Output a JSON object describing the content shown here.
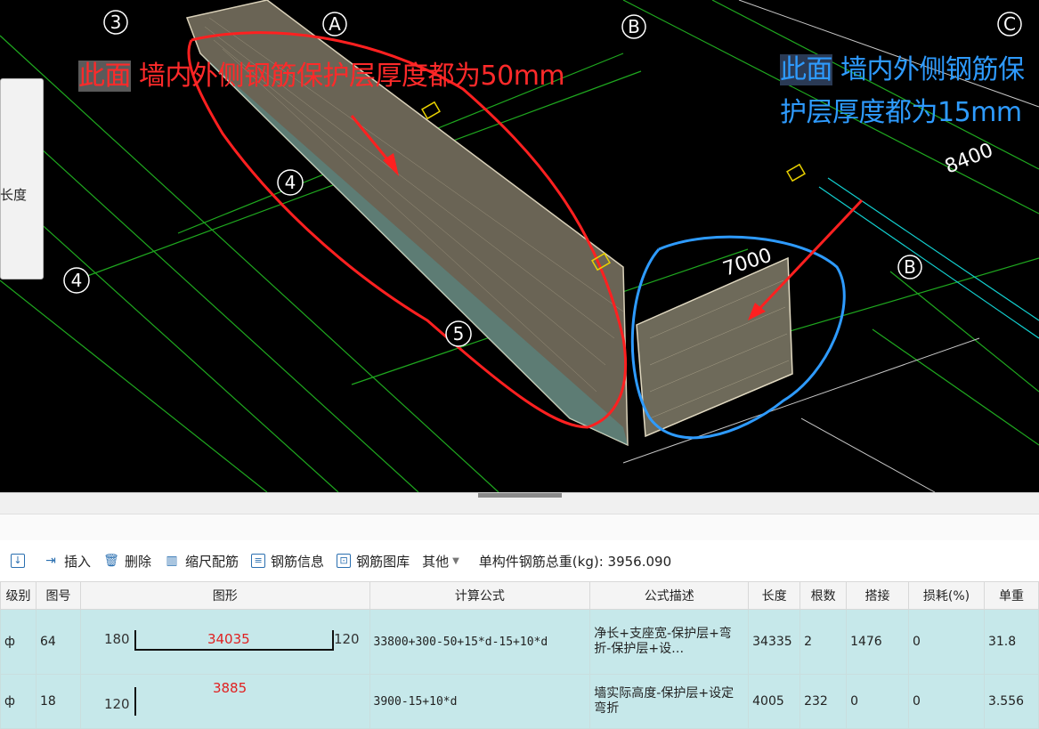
{
  "cad": {
    "axis_labels": [
      "3",
      "A",
      "B",
      "C",
      "4",
      "4",
      "5",
      "B"
    ],
    "dims": [
      "8400",
      "7000"
    ],
    "left_panel_label": "长度",
    "annotation_red": {
      "hl": "此面",
      "text": " 墙内外侧钢筋保护层厚度都为50mm"
    },
    "annotation_blue": {
      "hl": "此面",
      "text": " 墙内外侧钢筋保护层厚度都为15mm"
    }
  },
  "toolbar": {
    "insert": "插入",
    "delete": "删除",
    "scale": "缩尺配筋",
    "rebar_info": "钢筋信息",
    "rebar_lib": "钢筋图库",
    "other": "其他",
    "total_label": "单构件钢筋总重(kg):",
    "total_value": "3956.090"
  },
  "table": {
    "headers": [
      "级别",
      "图号",
      "图形",
      "计算公式",
      "公式描述",
      "长度",
      "根数",
      "搭接",
      "损耗(%)",
      "单重"
    ],
    "rows": [
      {
        "grade": "ф",
        "fig": "64",
        "left": "180",
        "mid": "34035",
        "right": "120",
        "formula": "33800+300-50+15*d-15+10*d",
        "desc": "净长+支座宽-保护层+弯折-保护层+设…",
        "len": "34335",
        "count": "2",
        "lap": "1476",
        "loss": "0",
        "unit": "31.8"
      },
      {
        "grade": "ф",
        "fig": "18",
        "left": "120",
        "mid": "3885",
        "right": "",
        "formula": "3900-15+10*d",
        "desc": "墙实际高度-保护层+设定弯折",
        "len": "4005",
        "count": "232",
        "lap": "0",
        "loss": "0",
        "unit": "3.556"
      }
    ]
  },
  "colors": {
    "red": "#ff2a2a",
    "blue": "#2e9bff",
    "row_bg": "#c6e8ea"
  }
}
